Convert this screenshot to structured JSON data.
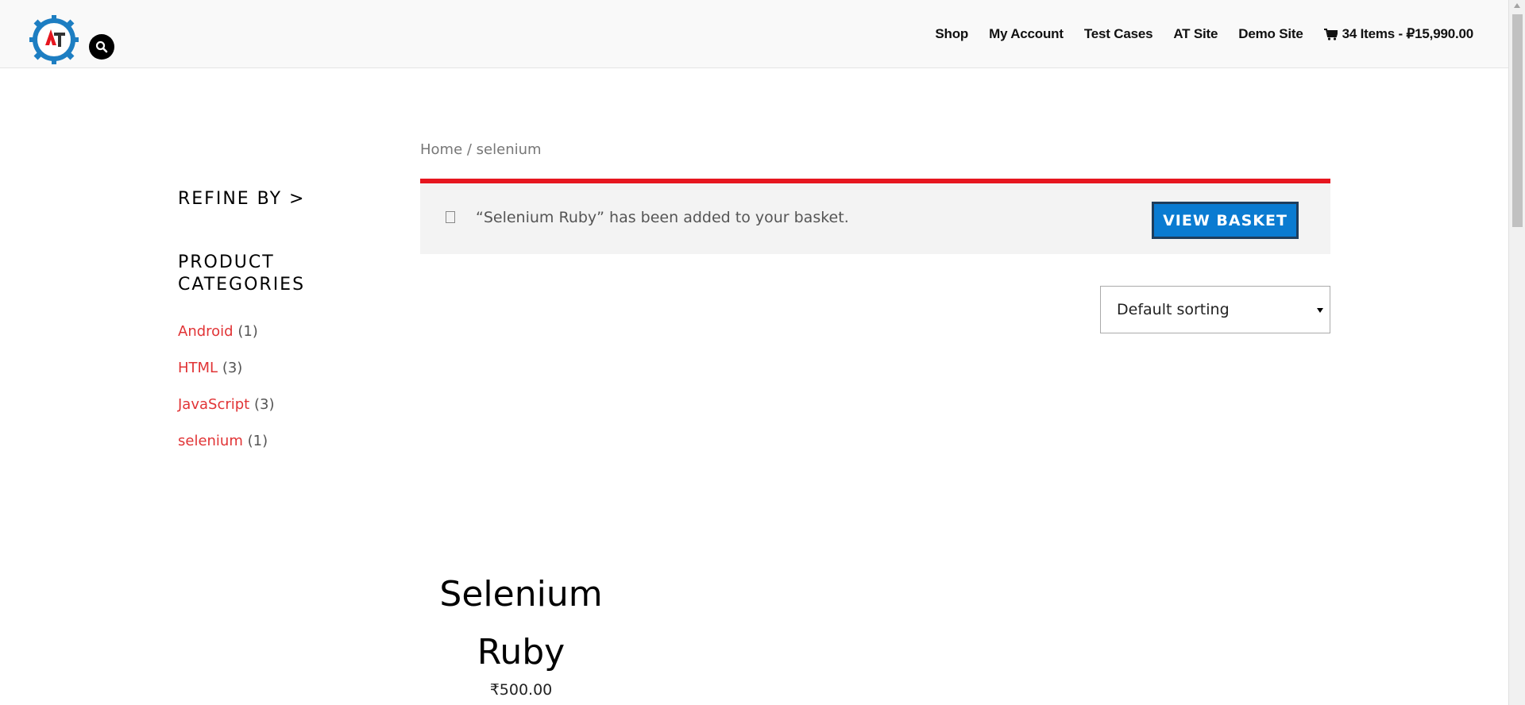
{
  "header": {
    "logo_alt": "AT",
    "search_icon": "search-icon",
    "nav": [
      {
        "label": "Shop"
      },
      {
        "label": "My Account"
      },
      {
        "label": "Test Cases"
      },
      {
        "label": "AT Site"
      },
      {
        "label": "Demo Site"
      }
    ],
    "cart": {
      "icon": "cart-icon",
      "label": "34 Items - ₽15,990.00"
    }
  },
  "sidebar": {
    "refine_label": "REFINE BY >",
    "categories_title": "PRODUCT CATEGORIES",
    "categories": [
      {
        "name": "Android",
        "count": "(1)"
      },
      {
        "name": "HTML",
        "count": "(3)"
      },
      {
        "name": "JavaScript",
        "count": "(3)"
      },
      {
        "name": "selenium",
        "count": "(1)"
      }
    ]
  },
  "breadcrumb": {
    "home": "Home",
    "separator": " / ",
    "current": "selenium"
  },
  "notice": {
    "message": "“Selenium Ruby” has been added to your basket.",
    "button_label": "VIEW BASKET",
    "accent_color": "#e6161f",
    "button_color": "#0a7bd1"
  },
  "sorting": {
    "selected": "Default sorting"
  },
  "products": [
    {
      "title_line1": "Selenium",
      "title_line2": "Ruby",
      "price": "₹500.00"
    }
  ]
}
